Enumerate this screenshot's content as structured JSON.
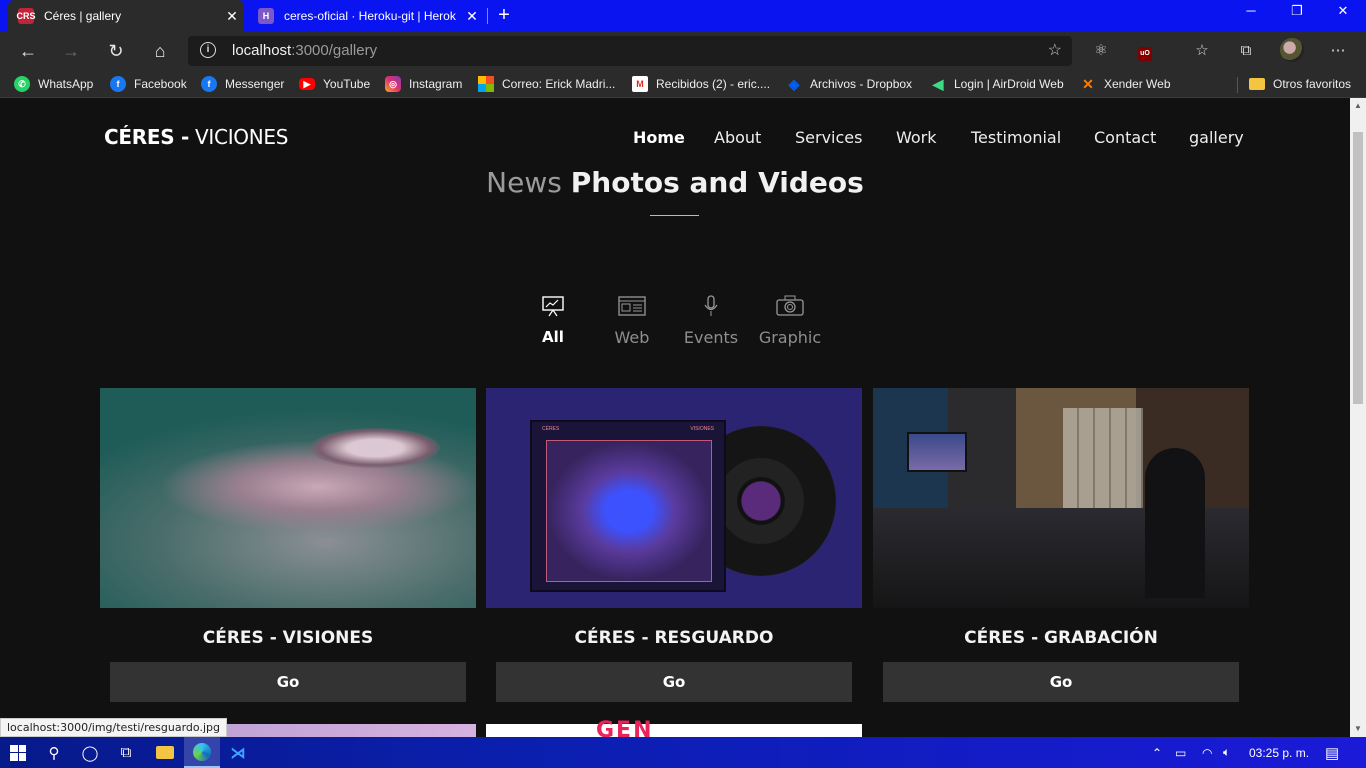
{
  "browser": {
    "tabs": [
      {
        "title": "Céres | gallery",
        "favicon": "ceres-favicon",
        "favicon_text": "CRS"
      },
      {
        "title": "ceres-oficial · Heroku-git | Herok",
        "favicon": "heroku-favicon",
        "favicon_text": "H"
      }
    ],
    "url_host": "localhost",
    "url_rest": ":3000/gallery",
    "window_controls": {
      "minimize": "─",
      "restore": "❐",
      "close": "✕"
    }
  },
  "bookmarks": [
    {
      "label": "WhatsApp",
      "icon": "whatsapp-icon"
    },
    {
      "label": "Facebook",
      "icon": "facebook-icon"
    },
    {
      "label": "Messenger",
      "icon": "messenger-icon"
    },
    {
      "label": "YouTube",
      "icon": "youtube-icon"
    },
    {
      "label": "Instagram",
      "icon": "instagram-icon"
    },
    {
      "label": "Correo: Erick Madri...",
      "icon": "microsoft-icon"
    },
    {
      "label": "Recibidos (2) - eric....",
      "icon": "gmail-icon"
    },
    {
      "label": "Archivos - Dropbox",
      "icon": "dropbox-icon"
    },
    {
      "label": "Login | AirDroid Web",
      "icon": "airdroid-icon"
    },
    {
      "label": "Xender Web",
      "icon": "xender-icon"
    },
    {
      "label": "Otros favoritos",
      "icon": "folder-icon"
    }
  ],
  "site": {
    "brand_bold": "CÉRES -",
    "brand_light": "VICIONES",
    "nav": [
      {
        "label": "Home",
        "active": true
      },
      {
        "label": "About"
      },
      {
        "label": "Services"
      },
      {
        "label": "Work"
      },
      {
        "label": "Testimonial"
      },
      {
        "label": "Contact"
      },
      {
        "label": "gallery"
      }
    ],
    "heading_light": "News",
    "heading_strong": "Photos and Videos",
    "filters": [
      {
        "label": "All",
        "icon": "presentation-icon",
        "active": true
      },
      {
        "label": "Web",
        "icon": "browser-window-icon"
      },
      {
        "label": "Events",
        "icon": "microphone-icon"
      },
      {
        "label": "Graphic",
        "icon": "camera-icon"
      }
    ],
    "cards": [
      {
        "title": "CÉRES - VISIONES",
        "button": "Go"
      },
      {
        "title": "CÉRES - RESGUARDO",
        "button": "Go",
        "sleeve_left": "CÉRES",
        "sleeve_right": "VISIONES"
      },
      {
        "title": "CÉRES - GRABACIÓN",
        "button": "Go"
      }
    ],
    "partial_card_text": "GEN"
  },
  "status_url": "localhost:3000/img/testi/resguardo.jpg",
  "taskbar": {
    "time": "03:25 p. m."
  }
}
